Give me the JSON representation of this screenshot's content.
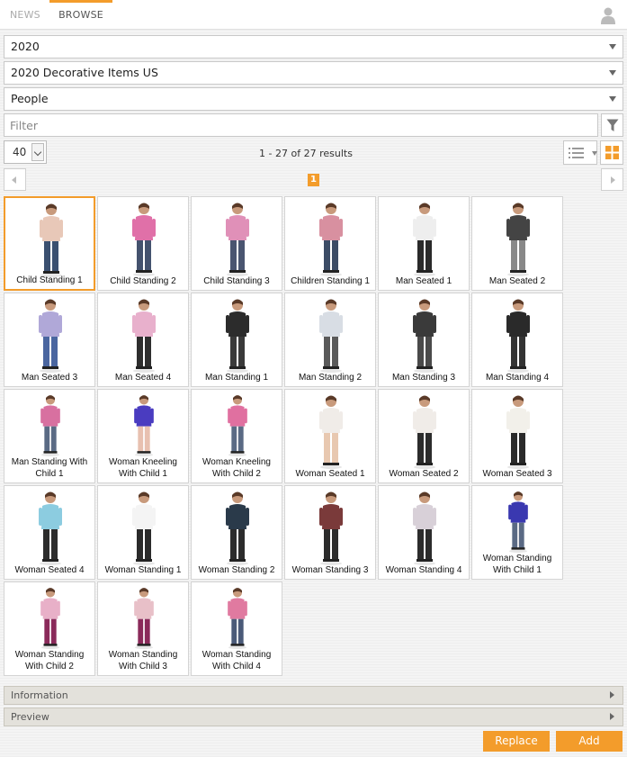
{
  "tabs": [
    {
      "label": "NEWS"
    },
    {
      "label": "BROWSE"
    }
  ],
  "selects": {
    "year": "2020",
    "catalog": "2020 Decorative Items US",
    "category": "People"
  },
  "filter": {
    "placeholder": "Filter",
    "value": ""
  },
  "toolbar": {
    "page_size": "40",
    "results_text": "1 - 27 of 27 results",
    "current_page": "1"
  },
  "colors": {
    "accent": "#f39c2b"
  },
  "items": [
    {
      "label": "Child Standing 1",
      "selected": true
    },
    {
      "label": "Child Standing 2"
    },
    {
      "label": "Child Standing 3"
    },
    {
      "label": "Children Standing 1"
    },
    {
      "label": "Man Seated 1"
    },
    {
      "label": "Man Seated 2"
    },
    {
      "label": "Man Seated 3"
    },
    {
      "label": "Man Seated 4"
    },
    {
      "label": "Man Standing 1"
    },
    {
      "label": "Man Standing 2"
    },
    {
      "label": "Man Standing 3"
    },
    {
      "label": "Man Standing 4"
    },
    {
      "label": "Man Standing With Child 1"
    },
    {
      "label": "Woman Kneeling With Child 1"
    },
    {
      "label": "Woman Kneeling With Child 2"
    },
    {
      "label": "Woman Seated 1"
    },
    {
      "label": "Woman Seated 2"
    },
    {
      "label": "Woman Seated 3"
    },
    {
      "label": "Woman Seated 4"
    },
    {
      "label": "Woman Standing 1"
    },
    {
      "label": "Woman Standing 2"
    },
    {
      "label": "Woman Standing 3"
    },
    {
      "label": "Woman Standing 4"
    },
    {
      "label": "Woman Standing With Child 1"
    },
    {
      "label": "Woman Standing With Child 2"
    },
    {
      "label": "Woman Standing With Child 3"
    },
    {
      "label": "Woman Standing With Child 4"
    }
  ],
  "panels": {
    "information": "Information",
    "preview": "Preview"
  },
  "actions": {
    "replace": "Replace",
    "add": "Add"
  }
}
